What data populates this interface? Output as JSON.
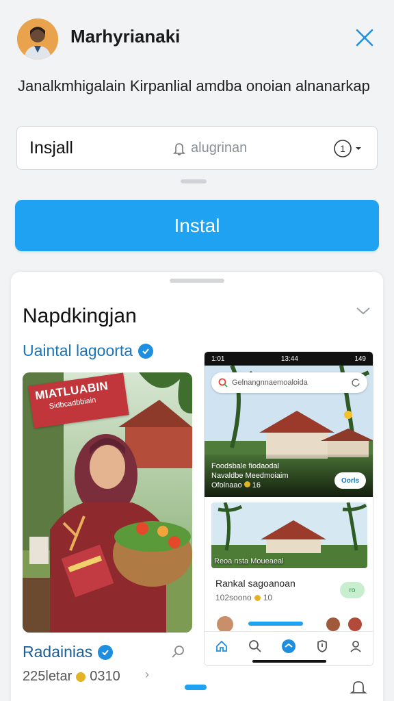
{
  "header": {
    "title": "Marhyrianaki",
    "avatar_icon": "user-avatar",
    "close_icon": "close-icon"
  },
  "description": "Janalkmhigalain Kirpanlial amdba onoian alnanarkap",
  "input": {
    "value": "Insjall",
    "placeholder": "alugrinan",
    "info_label": "1"
  },
  "install_button": "Instal",
  "section": {
    "title": "Napdkingjan",
    "verified_label": "Uaintal lagoorta",
    "badge_title": "MIATLUABIN",
    "badge_sub": "Sidbcadbbiain",
    "user_name": "Radainias",
    "user_stats_left": "225letar",
    "user_stats_right": "0310"
  },
  "phone": {
    "status_left": "1:01",
    "status_center": "13:44",
    "status_right": "149",
    "search_text": "Gelnangnnaemoaloida",
    "shot1_line1": "Foodsbale fiodaodal",
    "shot1_line2": "Navaldbe Meedmoiaim",
    "shot1_line3": "Ofolnaao",
    "shot1_rating": "16",
    "shot1_button": "Oorls",
    "shot2_caption": "Reoa nsta Moueaeal",
    "card2_title": "Rankal sagoanoan",
    "card2_sub": "102soono",
    "card2_sub_rating": "10",
    "card2_pill": "ro"
  },
  "colors": {
    "accent": "#1ea2f1",
    "verified": "#1e8fe0",
    "badge": "#c0363a",
    "link": "#1b74b8"
  }
}
